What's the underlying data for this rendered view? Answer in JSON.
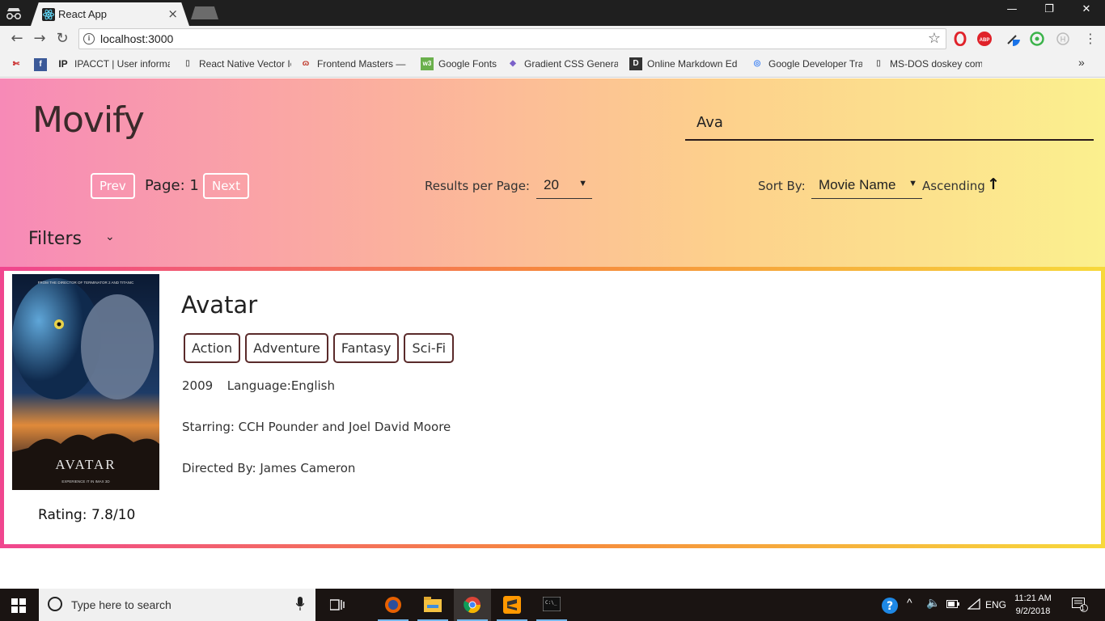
{
  "browser": {
    "tab_title": "React App",
    "tab_close": "×",
    "url": "localhost:3000",
    "window_controls": {
      "minimize": "—",
      "restore": "❐",
      "close": "✕"
    },
    "bookmarks": [
      {
        "label": "IPACCT | User informa",
        "icon": "ipacct-icon"
      },
      {
        "label": "React Native Vector Ic",
        "icon": "page-icon"
      },
      {
        "label": "Frontend Masters —",
        "icon": "frontend-masters-icon"
      },
      {
        "label": "Google Fonts",
        "icon": "google-fonts-icon"
      },
      {
        "label": "Gradient CSS Generat",
        "icon": "gradient-icon"
      },
      {
        "label": "Online Markdown Ed",
        "icon": "markdown-icon"
      },
      {
        "label": "Google Developer Tra",
        "icon": "google-dev-icon"
      },
      {
        "label": "MS-DOS doskey com",
        "icon": "page-icon"
      }
    ],
    "bookmarks_more": "»"
  },
  "app": {
    "logo": "Movify",
    "search_value": "Ava",
    "pagination": {
      "prev": "Prev",
      "page_label": "Page: 1",
      "next": "Next"
    },
    "results_per_page": {
      "label": "Results per Page:",
      "value": "20"
    },
    "sort": {
      "label": "Sort By:",
      "value": "Movie Name",
      "order": "Ascending",
      "order_icon": "arrow-up-icon"
    },
    "filters": {
      "label": "Filters",
      "icon": "chevron-down-icon"
    },
    "colors": {
      "header_gradient": [
        "#f78ab7",
        "#fbb09e",
        "#fdd08c",
        "#fbf08e"
      ],
      "card_border": [
        "#f0468f",
        "#f6893d",
        "#f7d93b"
      ]
    }
  },
  "movie": {
    "title": "Avatar",
    "genres": [
      "Action",
      "Adventure",
      "Fantasy",
      "Sci-Fi"
    ],
    "year": "2009",
    "language": "Language:English",
    "starring": "Starring: CCH Pounder and Joel David Moore",
    "director": "Directed By: James Cameron",
    "rating": "Rating: 7.8/10",
    "poster_title": "AVATAR",
    "poster_tagline": "FROM THE DIRECTOR OF TERMINATOR 2 AND TITANIC",
    "poster_footer": "EXPERIENCE IT IN IMAX 3D"
  },
  "taskbar": {
    "search_placeholder": "Type here to search",
    "lang": "ENG",
    "time": "11:21 AM",
    "date": "9/2/2018",
    "notifications": "1"
  }
}
